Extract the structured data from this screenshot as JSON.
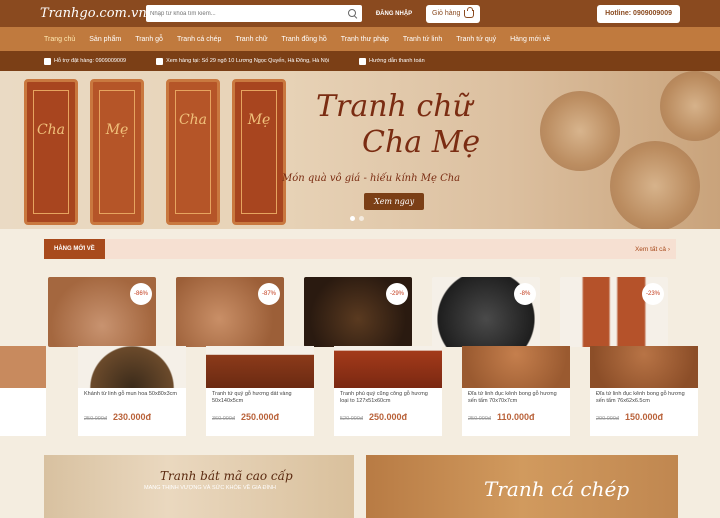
{
  "header": {
    "logo": "Tranhgo.com.vn",
    "search_placeholder": "Nhập từ khóa tìm kiếm...",
    "login": "ĐĂNG NHẬP",
    "cart": "Giỏ hàng",
    "hotline": "Hotline: 0909009009"
  },
  "nav": [
    "Trang chủ",
    "Sản phẩm",
    "Tranh gỗ",
    "Tranh cá chép",
    "Tranh chữ",
    "Tranh đồng hồ",
    "Tranh thư pháp",
    "Tranh tứ linh",
    "Tranh tứ quý",
    "Hàng mới về"
  ],
  "infobar": {
    "support": "Hỗ trợ đặt hàng: 0909009009",
    "address": "Xem hàng tại: Số 29 ngõ 10 Lương Ngọc Quyến, Hà Đông, Hà Nội",
    "guide": "Hướng dẫn thanh toán"
  },
  "banner": {
    "title1": "Tranh chữ",
    "title2": "Cha Mẹ",
    "subtitle": "Món quà vô giá - hiếu kính Mẹ Cha",
    "cta": "Xem ngay",
    "panel_glyphs": [
      "Cha",
      "Mẹ",
      "Cha",
      "Mẹ"
    ]
  },
  "section": {
    "label": "HÀNG MỚI VỀ",
    "see_all": "Xem tất cả  ›"
  },
  "back_badges": [
    "-86%",
    "-87%",
    "-29%",
    "-8%",
    "-23%"
  ],
  "products": [
    {
      "name": "",
      "old": "",
      "new": ""
    },
    {
      "name": "Khánh từ linh gỗ mun hoa 50x80x3cm",
      "old": "250.000đ",
      "new": "230.000đ"
    },
    {
      "name": "Tranh tứ quý gỗ hương dát vàng 50x140x5cm",
      "old": "360.000đ",
      "new": "250.000đ"
    },
    {
      "name": "Tranh phú quý cũng công gỗ hương loại to 127x51x60cm",
      "old": "520.000đ",
      "new": "250.000đ"
    },
    {
      "name": "Đĩa tứ linh đục kênh bong gỗ hương sến tẩm 70x70x7cm",
      "old": "250.000đ",
      "new": "110.000đ"
    },
    {
      "name": "Đĩa tứ linh đục kênh bong gỗ hương sến tẩm 76x62x6.5cm",
      "old": "200.000đ",
      "new": "150.000đ"
    }
  ],
  "promos": {
    "p1_title": "Tranh bát mã cao cấp",
    "p1_sub": "MANG THỊNH VƯỢNG VÀ SỨC KHỎE VỀ GIA ĐÌNH",
    "p2_title": "Tranh cá chép"
  }
}
